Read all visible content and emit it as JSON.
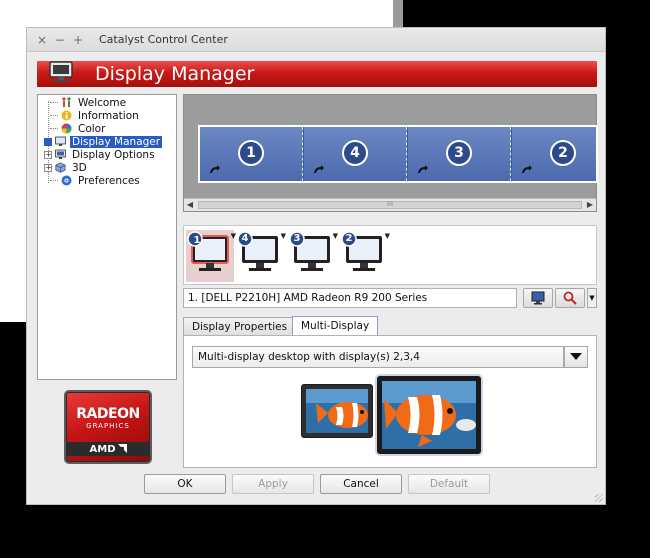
{
  "window": {
    "title": "Catalyst Control Center",
    "controls": [
      "×",
      "−",
      "+"
    ]
  },
  "banner": {
    "title": "Display Manager"
  },
  "tree": {
    "items": [
      {
        "label": "Welcome",
        "icon": "welcome-icon"
      },
      {
        "label": "Information",
        "icon": "information-icon"
      },
      {
        "label": "Color",
        "icon": "color-wheel-icon"
      },
      {
        "label": "Display Manager",
        "icon": "display-manager-icon",
        "selected": true
      },
      {
        "label": "Display Options",
        "icon": "display-options-icon"
      },
      {
        "label": "3D",
        "icon": "3d-icon"
      },
      {
        "label": "Preferences",
        "icon": "preferences-icon"
      }
    ]
  },
  "logo": {
    "line1": "RADEON",
    "line2": "GRAPHICS",
    "line3": "AMD"
  },
  "desktop": {
    "displays": [
      "1",
      "4",
      "3",
      "2"
    ],
    "scroll_thumb_grip": "III"
  },
  "monitors": [
    "1",
    "4",
    "3",
    "2"
  ],
  "display_selector": {
    "value": "1.  [DELL P2210H] AMD Radeon R9 200 Series"
  },
  "tabs": [
    {
      "label": "Display Properties",
      "active": false
    },
    {
      "label": "Multi-Display",
      "active": true
    }
  ],
  "multi_display": {
    "mode": "Multi-display desktop with display(s) 2,3,4"
  },
  "buttons": {
    "ok": "OK",
    "apply": "Apply",
    "cancel": "Cancel",
    "default": "Default"
  },
  "colors": {
    "banner_red": "#c91a17",
    "selection_blue": "#2a5bbf",
    "desktop_tile_blue": "#5673b4"
  }
}
